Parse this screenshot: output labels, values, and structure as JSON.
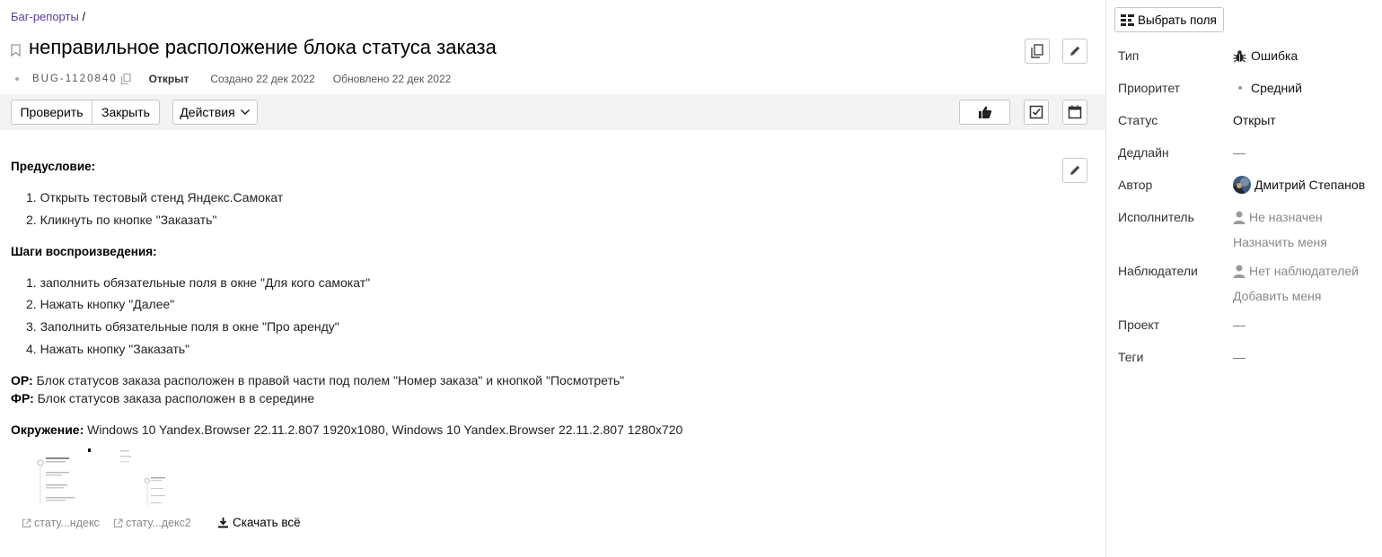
{
  "breadcrumb": {
    "link": "Баг-репорты",
    "sep": "/"
  },
  "issue": {
    "title": "неправильное расположение блока статуса заказа",
    "key": "BUG-1120840",
    "status": "Открыт",
    "created": "Создано 22 дек 2022",
    "updated": "Обновлено 22 дек 2022"
  },
  "toolbar": {
    "check": "Проверить",
    "close": "Закрыть",
    "actions": "Действия"
  },
  "description": {
    "precondition_title": "Предусловие:",
    "precondition_items": [
      "1. Открыть тестовый стенд Яндекс.Самокат",
      "2. Кликнуть по кнопке \"Заказать\""
    ],
    "steps_title": "Шаги воспроизведения:",
    "steps_items": [
      "1. заполнить обязательные поля в окне \"Для кого самокат\"",
      "2. Нажать кнопку \"Далее\"",
      "3. Заполнить обязательные поля в окне \"Про аренду\"",
      "4. Нажать кнопку \"Заказать\""
    ],
    "expected_label": "ОР:",
    "expected_text": " Блок статусов заказа расположен в правой части под полем \"Номер заказа\" и кнопкой \"Посмотреть\"",
    "actual_label": "ФР:",
    "actual_text": " Блок статусов заказа расположен в в середине",
    "env_label": "Окружение:",
    "env_text": " Windows 10 Yandex.Browser 22.11.2.807 1920x1080, Windows 10 Yandex.Browser 22.11.2.807 1280x720"
  },
  "attachments": {
    "items": [
      "стату...ндекс",
      "стату...декс2"
    ],
    "download_all": "Скачать всё"
  },
  "sidebar": {
    "select_fields": "Выбрать поля",
    "fields": {
      "type": {
        "label": "Тип",
        "value": "Ошибка"
      },
      "priority": {
        "label": "Приоритет",
        "value": "Средний"
      },
      "status": {
        "label": "Статус",
        "value": "Открыт"
      },
      "deadline": {
        "label": "Дедлайн",
        "value": "—"
      },
      "author": {
        "label": "Автор",
        "value": "Дмитрий Степанов"
      },
      "assignee": {
        "label": "Исполнитель",
        "value": "Не назначен",
        "action": "Назначить меня"
      },
      "followers": {
        "label": "Наблюдатели",
        "value": "Нет наблюдателей",
        "action": "Добавить меня"
      },
      "project": {
        "label": "Проект",
        "value": "—"
      },
      "tags": {
        "label": "Теги",
        "value": "—"
      }
    }
  },
  "colors": {
    "link": "#5b3c9e",
    "toolbar_bg": "#f3f3f3",
    "border": "#c6c6c6"
  }
}
